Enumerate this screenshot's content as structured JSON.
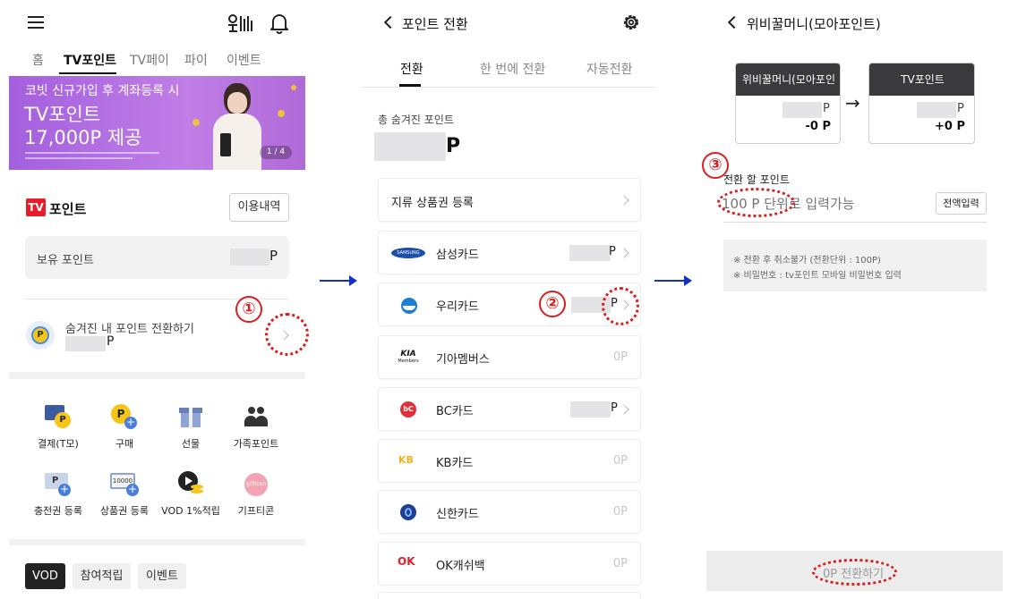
{
  "screen1": {
    "nav_tabs": [
      "홈",
      "TV포인트",
      "TV페이",
      "파이",
      "이벤트"
    ],
    "active_tab_index": 1,
    "banner": {
      "line1": "코빗 신규가입 후 계좌등록 시",
      "line2": "TV포인트",
      "line3": "17,000P 제공",
      "pager": "1 / 4",
      "background": "#b36fe0"
    },
    "tvpoint_logo_badge": "TV",
    "tvpoint_logo_text": "포인트",
    "history_button": "이용내역",
    "holding_label": "보유 포인트",
    "holding_unit": "P",
    "hidden_title": "숨겨진 내 포인트 전환하기",
    "hidden_unit": "P",
    "step_marker": "①",
    "grid": [
      {
        "label": "결제(T모)",
        "icon": "tv-pay-icon"
      },
      {
        "label": "구매",
        "icon": "point-buy-icon"
      },
      {
        "label": "선물",
        "icon": "gift-icon"
      },
      {
        "label": "가족포인트",
        "icon": "family-icon"
      },
      {
        "label": "충전권 등록",
        "icon": "charge-voucher-icon"
      },
      {
        "label": "상품권 등록",
        "icon": "gift-voucher-icon"
      },
      {
        "label": "VOD 1%적립",
        "icon": "vod-coin-icon"
      },
      {
        "label": "기프티콘",
        "icon": "gifticon-icon"
      }
    ],
    "gifticon_logo_text": "gifticon",
    "bottom_tabs": [
      "VOD",
      "참여적립",
      "이벤트"
    ]
  },
  "screen2": {
    "title": "포인트 전환",
    "tabs": [
      "전환",
      "한 번에 전환",
      "자동전환"
    ],
    "active_tab_index": 0,
    "total_label": "총 숨겨진 포인트",
    "total_unit": "P",
    "voucher_row": "지류 상품권 등록",
    "step_marker": "②",
    "cards": [
      {
        "name": "삼성카드",
        "value": "P",
        "has_chevron": true,
        "icon": "samsung-logo-icon",
        "icon_text": "SAMSUNG"
      },
      {
        "name": "우리카드",
        "value": "P",
        "has_chevron": true,
        "icon": "woori-logo-icon"
      },
      {
        "name": "기아멤버스",
        "value": "0P",
        "has_chevron": false,
        "icon": "kia-logo-icon",
        "icon_text": "KIA",
        "icon_subtext": "Members"
      },
      {
        "name": "BC카드",
        "value": "P",
        "has_chevron": true,
        "icon": "bc-logo-icon",
        "icon_text": "bC"
      },
      {
        "name": "KB카드",
        "value": "0P",
        "has_chevron": false,
        "icon": "kb-logo-icon",
        "icon_text": "KB"
      },
      {
        "name": "신한카드",
        "value": "0P",
        "has_chevron": false,
        "icon": "shinhan-logo-icon"
      },
      {
        "name": "OK캐쉬백",
        "value": "0P",
        "has_chevron": false,
        "icon": "okcashbag-logo-icon",
        "icon_text": "OK"
      }
    ]
  },
  "screen3": {
    "title": "위비꿀머니(모아포인트)",
    "from_box": {
      "title": "위비꿀머니(모아포인",
      "unit": "P",
      "delta": "-0 P"
    },
    "to_box": {
      "title": "TV포인트",
      "unit": "P",
      "delta": "+0 P"
    },
    "step_marker": "③",
    "input_label": "전환 할 포인트",
    "input_placeholder": "100 P 단위로 입력가능",
    "all_button": "전액입력",
    "notes": [
      "※ 전환 후 취소불가 (전환단위 : 100P)",
      "※ 비밀번호 : tv포인트 모바일 비밀번호 입력"
    ],
    "convert_button": "0P 전환하기"
  },
  "colors": {
    "accent_red": "#e61e2a",
    "annotation_red": "#d62020",
    "arrow_blue": "#1430c8",
    "dark_box": "#3a3a3c"
  }
}
